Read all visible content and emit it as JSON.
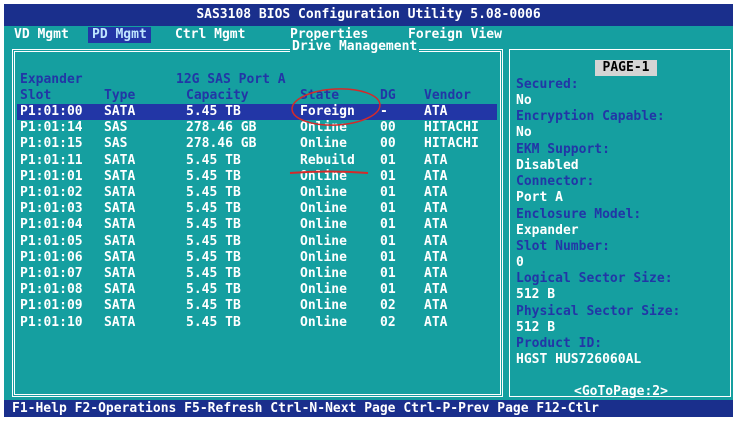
{
  "app_title": "SAS3108 BIOS Configuration Utility 5.08-0006",
  "tabs": [
    {
      "label": "VD Mgmt"
    },
    {
      "label": "PD Mgmt",
      "active": true
    },
    {
      "label": "Ctrl Mgmt"
    },
    {
      "label": "Properties"
    },
    {
      "label": "Foreign View"
    }
  ],
  "panel_title": "Drive Management",
  "expander": {
    "label": "Expander",
    "port": "12G SAS Port A"
  },
  "columns": {
    "slot": "Slot",
    "type": "Type",
    "capacity": "Capacity",
    "state": "State",
    "dg": "DG",
    "vendor": "Vendor"
  },
  "drives": [
    {
      "slot": "P1:01:00",
      "type": "SATA",
      "capacity": "5.45 TB",
      "state": "Foreign",
      "dg": "-",
      "vendor": "ATA",
      "selected": true
    },
    {
      "slot": "P1:01:14",
      "type": "SAS",
      "capacity": "278.46 GB",
      "state": "Online",
      "dg": "00",
      "vendor": "HITACHI"
    },
    {
      "slot": "P1:01:15",
      "type": "SAS",
      "capacity": "278.46 GB",
      "state": "Online",
      "dg": "00",
      "vendor": "HITACHI"
    },
    {
      "slot": "P1:01:11",
      "type": "SATA",
      "capacity": "5.45 TB",
      "state": "Rebuild",
      "dg": "01",
      "vendor": "ATA"
    },
    {
      "slot": "P1:01:01",
      "type": "SATA",
      "capacity": "5.45 TB",
      "state": "Online",
      "dg": "01",
      "vendor": "ATA"
    },
    {
      "slot": "P1:01:02",
      "type": "SATA",
      "capacity": "5.45 TB",
      "state": "Online",
      "dg": "01",
      "vendor": "ATA"
    },
    {
      "slot": "P1:01:03",
      "type": "SATA",
      "capacity": "5.45 TB",
      "state": "Online",
      "dg": "01",
      "vendor": "ATA"
    },
    {
      "slot": "P1:01:04",
      "type": "SATA",
      "capacity": "5.45 TB",
      "state": "Online",
      "dg": "01",
      "vendor": "ATA"
    },
    {
      "slot": "P1:01:05",
      "type": "SATA",
      "capacity": "5.45 TB",
      "state": "Online",
      "dg": "01",
      "vendor": "ATA"
    },
    {
      "slot": "P1:01:06",
      "type": "SATA",
      "capacity": "5.45 TB",
      "state": "Online",
      "dg": "01",
      "vendor": "ATA"
    },
    {
      "slot": "P1:01:07",
      "type": "SATA",
      "capacity": "5.45 TB",
      "state": "Online",
      "dg": "01",
      "vendor": "ATA"
    },
    {
      "slot": "P1:01:08",
      "type": "SATA",
      "capacity": "5.45 TB",
      "state": "Online",
      "dg": "01",
      "vendor": "ATA"
    },
    {
      "slot": "P1:01:09",
      "type": "SATA",
      "capacity": "5.45 TB",
      "state": "Online",
      "dg": "02",
      "vendor": "ATA"
    },
    {
      "slot": "P1:01:10",
      "type": "SATA",
      "capacity": "5.45 TB",
      "state": "Online",
      "dg": "02",
      "vendor": "ATA"
    }
  ],
  "info": {
    "page": "PAGE-1",
    "items": [
      {
        "label": "Secured:",
        "value": "No"
      },
      {
        "label": "Encryption Capable:",
        "value": "No"
      },
      {
        "label": "EKM Support:",
        "value": "Disabled"
      },
      {
        "label": "Connector:",
        "value": "Port A"
      },
      {
        "label": "Enclosure Model:",
        "value": "Expander"
      },
      {
        "label": "Slot Number:",
        "value": "0"
      },
      {
        "label": "Logical Sector Size:",
        "value": "512 B"
      },
      {
        "label": "Physical Sector Size:",
        "value": "512 B"
      },
      {
        "label": "Product ID:",
        "value": "HGST HUS726060AL"
      }
    ],
    "goto": "<GoToPage:2>"
  },
  "status_bar": "F1-Help F2-Operations F5-Refresh Ctrl-N-Next Page Ctrl-P-Prev Page F12-Ctlr",
  "colors": {
    "screen_bg": "#159fa0",
    "title_bar": "#1a2f8c",
    "selection": "#2236a6",
    "annotation": "#d42a2a"
  },
  "annotations": {
    "circle_on": "Foreign",
    "underline_on": "Rebuild"
  }
}
